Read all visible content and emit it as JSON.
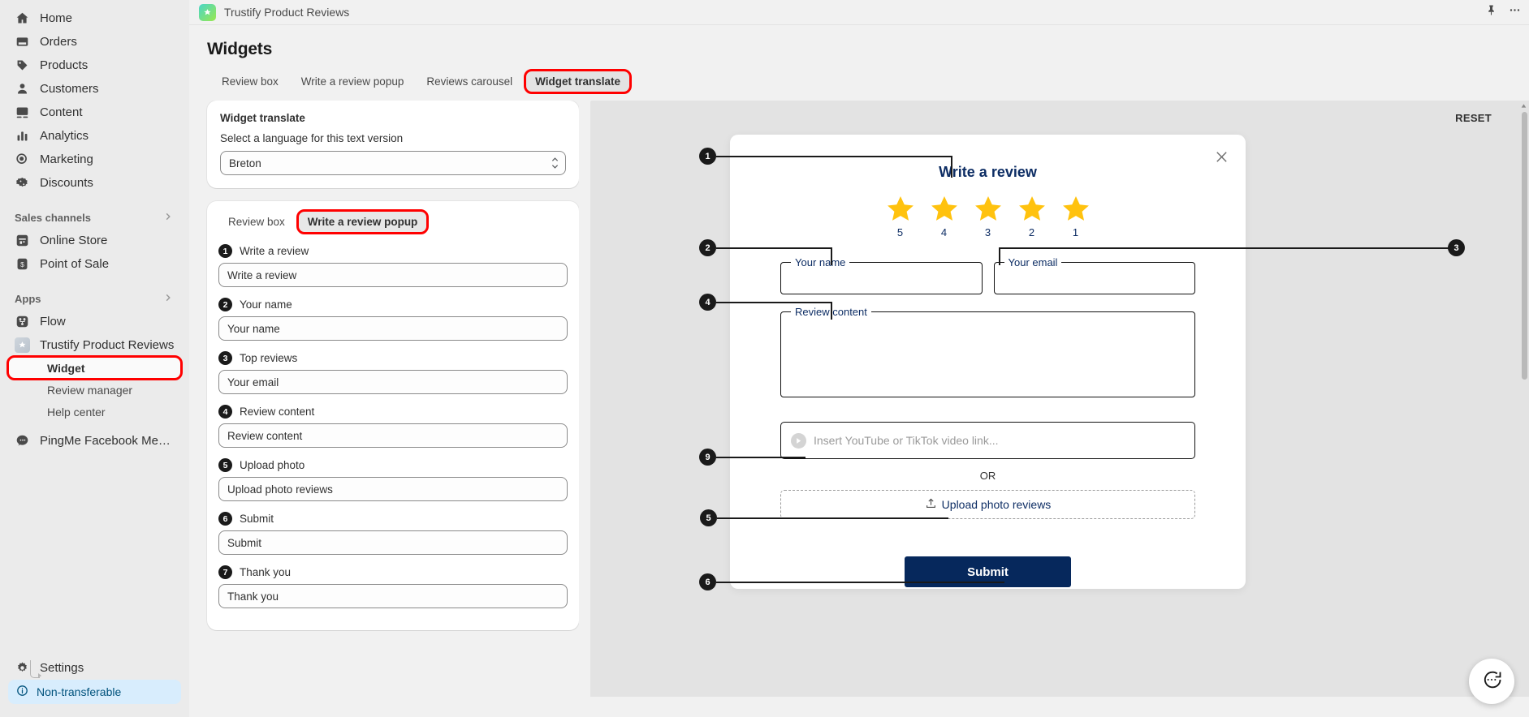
{
  "topbar": {
    "app_name": "Trustify Product Reviews",
    "pin_icon": "pin-icon",
    "more_icon": "more-icon"
  },
  "sidebar": {
    "primary": [
      {
        "label": "Home",
        "icon": "home-icon"
      },
      {
        "label": "Orders",
        "icon": "orders-icon"
      },
      {
        "label": "Products",
        "icon": "tag-icon"
      },
      {
        "label": "Customers",
        "icon": "person-icon"
      },
      {
        "label": "Content",
        "icon": "content-icon"
      },
      {
        "label": "Analytics",
        "icon": "bar-chart-icon"
      },
      {
        "label": "Marketing",
        "icon": "target-icon"
      },
      {
        "label": "Discounts",
        "icon": "discount-icon"
      }
    ],
    "sales_channels_label": "Sales channels",
    "sales_channels": [
      {
        "label": "Online Store",
        "icon": "storefront-icon"
      },
      {
        "label": "Point of Sale",
        "icon": "pos-icon"
      }
    ],
    "apps_label": "Apps",
    "apps": [
      {
        "label": "Flow",
        "icon": "flow-icon"
      },
      {
        "label": "Trustify Product Reviews",
        "icon": "trustify-icon"
      }
    ],
    "app_subitems": [
      {
        "label": "Widget",
        "active": true
      },
      {
        "label": "Review manager",
        "active": false
      },
      {
        "label": "Help center",
        "active": false
      }
    ],
    "apps_more": [
      {
        "label": "PingMe Facebook Messen...",
        "icon": "messenger-icon"
      }
    ],
    "settings_label": "Settings",
    "settings_icon": "gear-icon",
    "banner_label": "Non-transferable",
    "banner_icon": "info-icon"
  },
  "page": {
    "title": "Widgets",
    "tabs": [
      {
        "label": "Review box",
        "active": false
      },
      {
        "label": "Write a review popup",
        "active": false
      },
      {
        "label": "Reviews carousel",
        "active": false
      },
      {
        "label": "Widget translate",
        "active": true,
        "highlighted": true
      }
    ]
  },
  "translate_card": {
    "title": "Widget translate",
    "subtitle": "Select a language for this text version",
    "selected_language": "Breton",
    "caret_icon": "chevron-updown-icon"
  },
  "editor_card": {
    "subtabs": [
      {
        "label": "Review box",
        "active": false
      },
      {
        "label": "Write a review popup",
        "active": true,
        "highlighted": true
      }
    ],
    "fields": [
      {
        "num": "1",
        "label": "Write a review",
        "value": "Write a review"
      },
      {
        "num": "2",
        "label": "Your name",
        "value": "Your name"
      },
      {
        "num": "3",
        "label": "Top reviews",
        "value": "Your email"
      },
      {
        "num": "4",
        "label": "Review content",
        "value": "Review content"
      },
      {
        "num": "5",
        "label": "Upload photo",
        "value": "Upload photo reviews"
      },
      {
        "num": "6",
        "label": "Submit",
        "value": "Submit"
      },
      {
        "num": "7",
        "label": "Thank you",
        "value": "Thank you"
      }
    ]
  },
  "preview": {
    "reset_label": "RESET",
    "close_icon": "close-icon",
    "popup_title": "Write a review",
    "stars": [
      "5",
      "4",
      "3",
      "2",
      "1"
    ],
    "star_color": "#ffc20e",
    "name_legend": "Your name",
    "email_legend": "Your email",
    "content_legend": "Review content",
    "video_placeholder": "Insert YouTube or TikTok video link...",
    "video_icon": "play-circle-icon",
    "or_label": "OR",
    "upload_label": "Upload photo reviews",
    "upload_icon": "upload-icon",
    "submit_label": "Submit",
    "accent_color": "#0d2d64",
    "submit_bg": "#06285c",
    "callouts": [
      {
        "num": "1"
      },
      {
        "num": "2"
      },
      {
        "num": "3"
      },
      {
        "num": "4"
      },
      {
        "num": "9"
      },
      {
        "num": "5"
      },
      {
        "num": "6"
      }
    ]
  },
  "chat": {
    "icon": "chat-icon"
  }
}
